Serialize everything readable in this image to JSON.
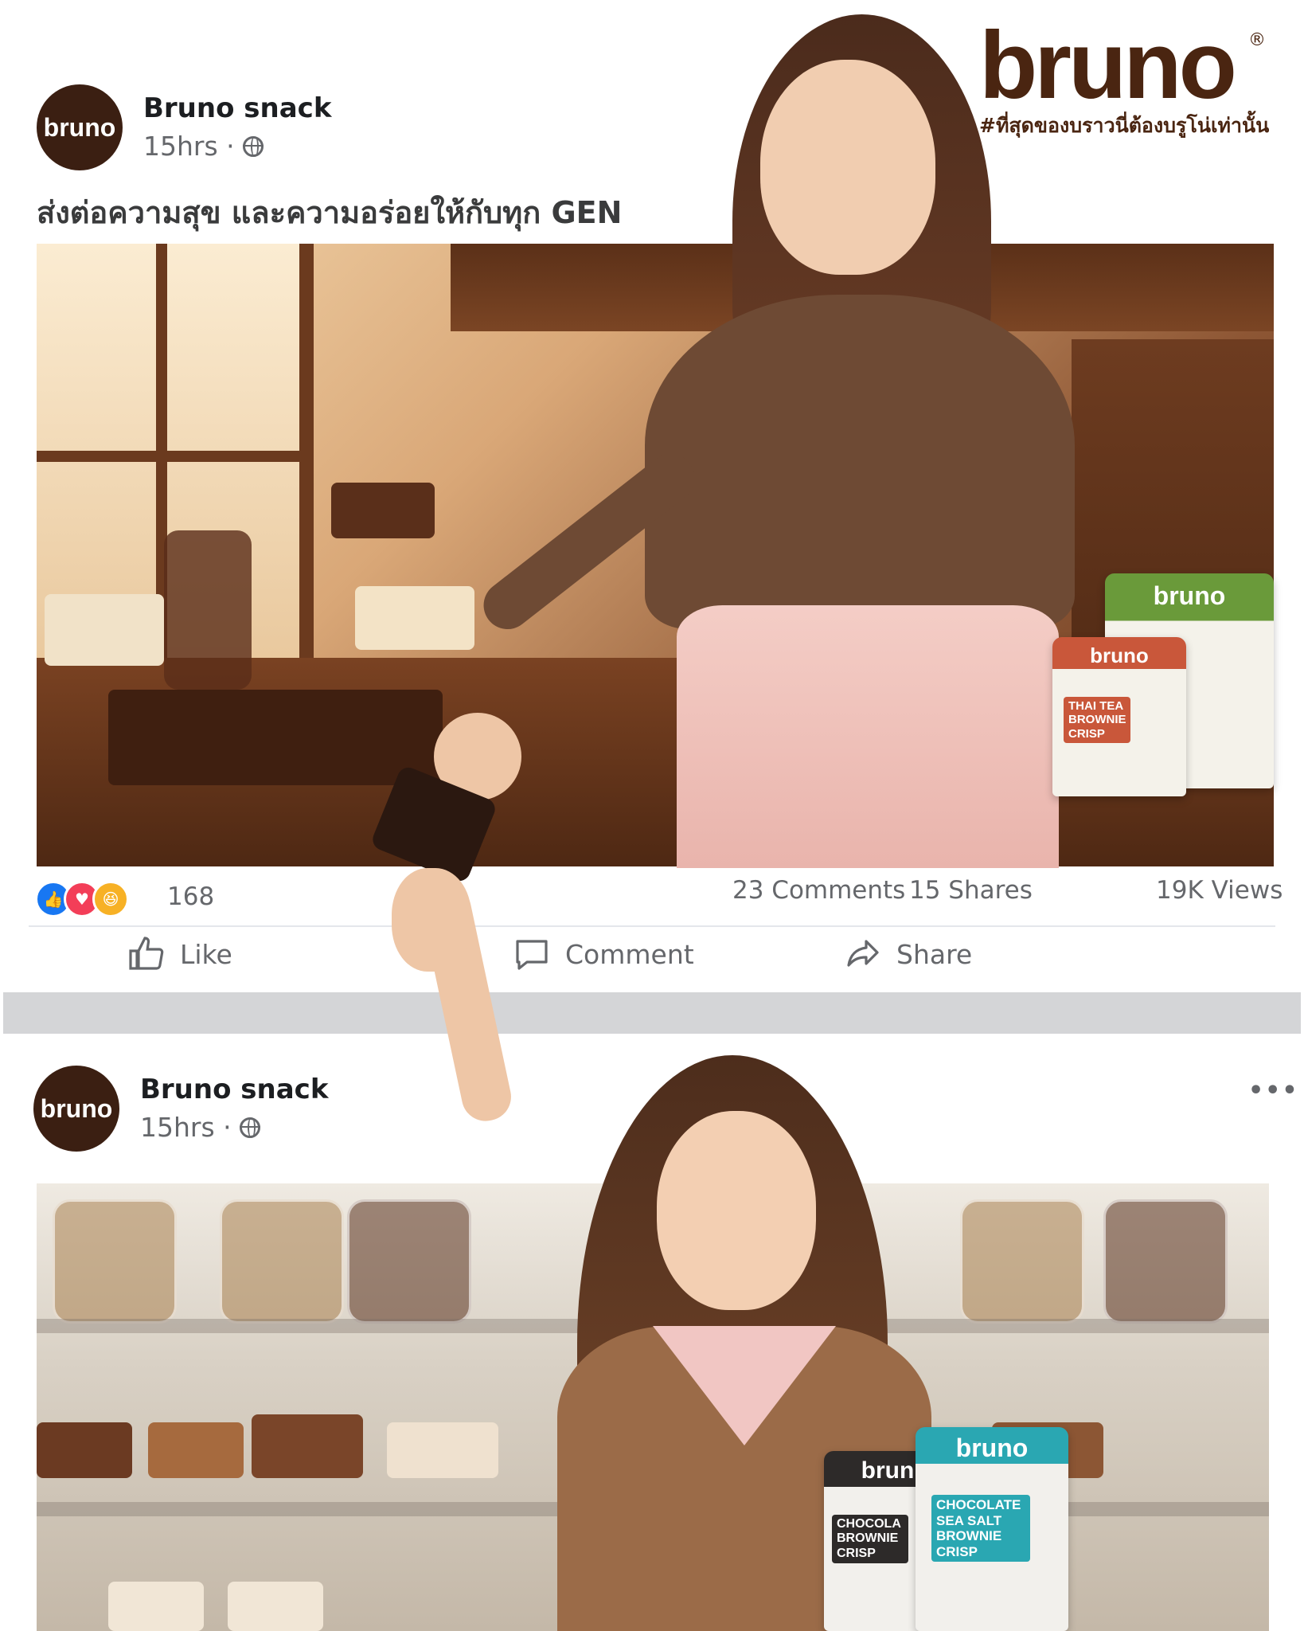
{
  "brand": {
    "logo": "bruno",
    "registered": "®",
    "tagline": "#ที่สุดของบราวนี่ต้องบรูโน่เท่านั้น"
  },
  "post1": {
    "avatar_text": "bruno",
    "page_name": "Bruno snack",
    "time": "15hrs ·",
    "caption": "ส่งต่อความสุข และความอร่อยให้กับทุก GEN",
    "products": {
      "green_pack_brand": "bruno",
      "orange_pack_brand": "bruno",
      "orange_pack_label": "THAI TEA BROWNIE CRISP"
    },
    "reactions": {
      "count": "168",
      "icons": [
        "like-icon",
        "love-icon",
        "haha-icon"
      ]
    },
    "comments": "23 Comments",
    "shares": "15 Shares",
    "views": "19K Views",
    "actions": {
      "like": "Like",
      "comment": "Comment",
      "share": "Share"
    }
  },
  "post2": {
    "avatar_text": "bruno",
    "page_name": "Bruno snack",
    "time": "15hrs ·",
    "more": "•••",
    "products": {
      "dark_pack_brand": "brun",
      "dark_pack_label": "CHOCOLA BROWNIE CRISP",
      "teal_pack_brand": "bruno",
      "teal_pack_label": "CHOCOLATE SEA SALT BROWNIE CRISP"
    }
  },
  "colors": {
    "brand_brown": "#4a2511",
    "fb_grey": "#65676b",
    "like_blue": "#1877f2",
    "love_red": "#f33e58",
    "haha_yellow": "#f7b125"
  }
}
